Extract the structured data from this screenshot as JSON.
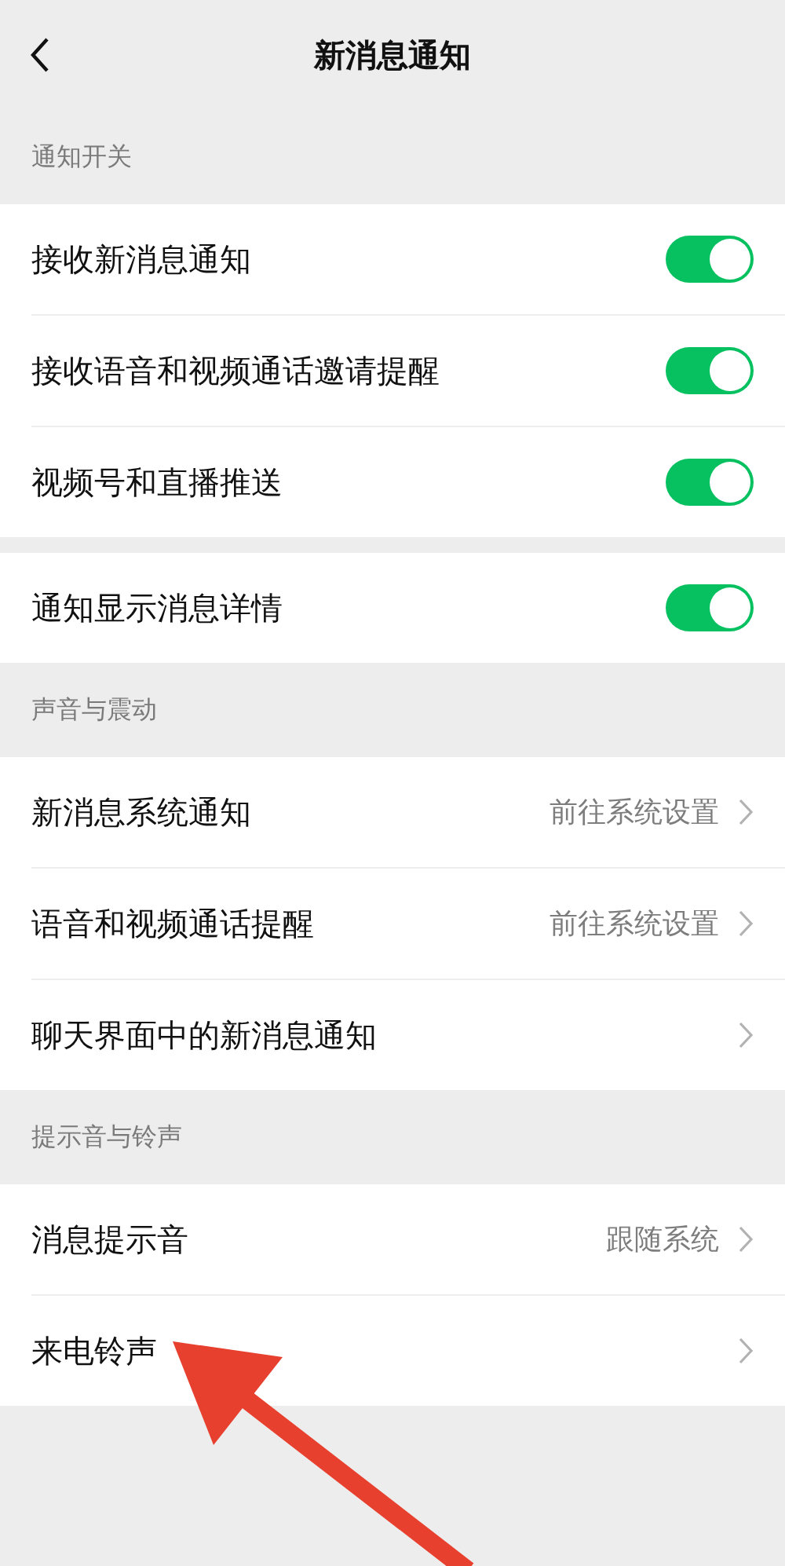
{
  "nav": {
    "title": "新消息通知"
  },
  "groups": [
    {
      "header": "通知开关",
      "rows": [
        {
          "kind": "toggle",
          "label": "接收新消息通知",
          "on": true
        },
        {
          "kind": "toggle",
          "label": "接收语音和视频通话邀请提醒",
          "on": true
        },
        {
          "kind": "toggle",
          "label": "视频号和直播推送",
          "on": true
        }
      ]
    },
    {
      "rows": [
        {
          "kind": "toggle",
          "label": "通知显示消息详情",
          "on": true
        }
      ]
    },
    {
      "header": "声音与震动",
      "rows": [
        {
          "kind": "link",
          "label": "新消息系统通知",
          "value": "前往系统设置"
        },
        {
          "kind": "link",
          "label": "语音和视频通话提醒",
          "value": "前往系统设置"
        },
        {
          "kind": "link",
          "label": "聊天界面中的新消息通知"
        }
      ]
    },
    {
      "header": "提示音与铃声",
      "rows": [
        {
          "kind": "link",
          "label": "消息提示音",
          "value": "跟随系统"
        },
        {
          "kind": "link",
          "label": "来电铃声"
        }
      ]
    }
  ]
}
